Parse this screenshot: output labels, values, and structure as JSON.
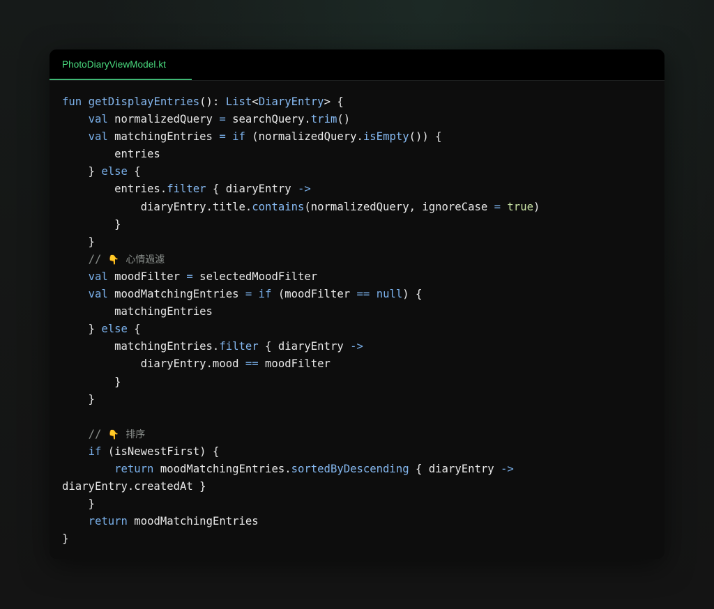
{
  "tab": {
    "filename": "PhotoDiaryViewModel.kt"
  },
  "comments": {
    "emoji": "👇",
    "mood_filter": "心情過濾",
    "sort": "排序"
  },
  "colors": {
    "accent_green": "#4ade80",
    "keyword_blue": "#7ab0ea",
    "literal_green": "#c9e3a5",
    "comment_gray": "#8a8f8c",
    "card_bg": "#0d0d0d"
  }
}
